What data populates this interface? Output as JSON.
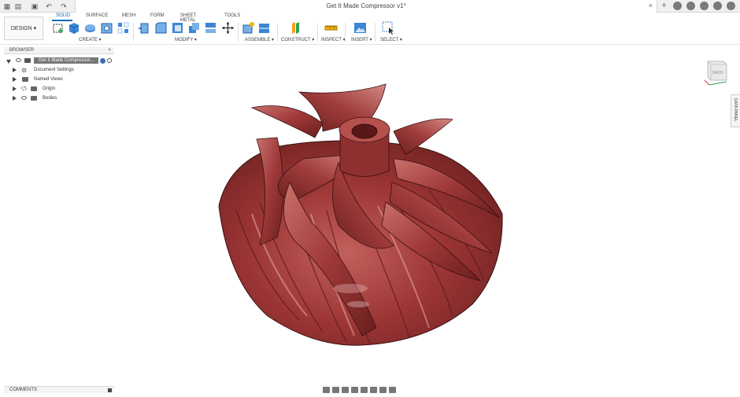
{
  "title_bar": {
    "document_title": "Get It Made Compressor v1*",
    "close_label": "×",
    "new_tab_label": "+"
  },
  "toolbar": {
    "workspace_label": "DESIGN ▾",
    "tabs": [
      "SOLID",
      "SURFACE",
      "MESH",
      "FORM",
      "SHEET METAL",
      "TOOLS"
    ],
    "active_tab": "SOLID",
    "groups": [
      "CREATE ▾",
      "MODIFY ▾",
      "ASSEMBLE ▾",
      "CONSTRUCT ▾",
      "INSPECT ▾",
      "INSERT ▾",
      "SELECT ▾"
    ]
  },
  "browser": {
    "header_label": "BROWSER",
    "header_control": "◐",
    "root_label": "Get It Made Compressor...",
    "items": [
      {
        "label": "Document Settings"
      },
      {
        "label": "Named Views"
      },
      {
        "label": "Origin"
      },
      {
        "label": "Bodies"
      }
    ]
  },
  "comments": {
    "label": "COMMENTS"
  },
  "viewcube": {
    "face_label": "BACK"
  },
  "side_panel": {
    "label": "DATA PANEL"
  },
  "colors": {
    "accent": "#0a6cb8",
    "model": "#9a3434",
    "model_highlight": "#c96a66",
    "model_shadow": "#6a1f1f"
  }
}
